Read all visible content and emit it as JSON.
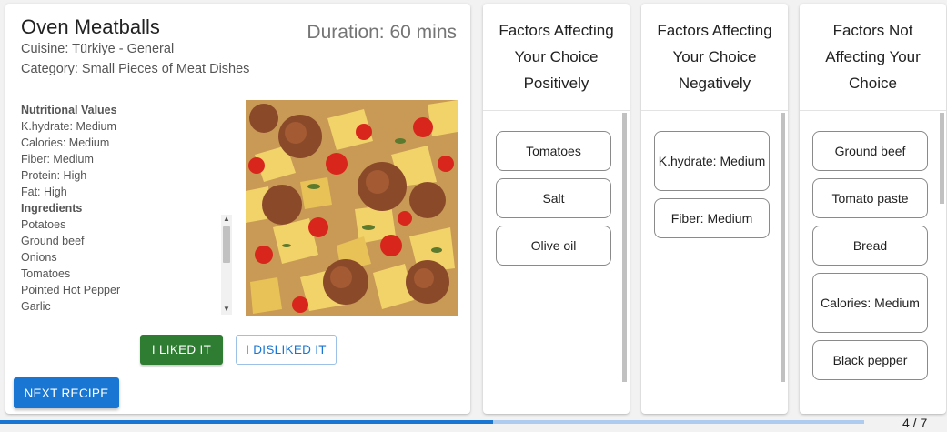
{
  "recipe": {
    "title": "Oven Meatballs",
    "cuisine": "Cuisine: Türkiye - General",
    "category": "Category: Small Pieces of Meat Dishes",
    "duration": "Duration: 60 mins",
    "info_lines": [
      {
        "text": "Nutritional Values",
        "heading": true
      },
      {
        "text": "K.hydrate: Medium",
        "heading": false
      },
      {
        "text": "Calories: Medium",
        "heading": false
      },
      {
        "text": "Fiber: Medium",
        "heading": false
      },
      {
        "text": "Protein: High",
        "heading": false
      },
      {
        "text": "Fat: High",
        "heading": false
      },
      {
        "text": "Ingredients",
        "heading": true
      },
      {
        "text": "Potatoes",
        "heading": false
      },
      {
        "text": "Ground beef",
        "heading": false
      },
      {
        "text": "Onions",
        "heading": false
      },
      {
        "text": "Tomatoes",
        "heading": false
      },
      {
        "text": "Pointed Hot Pepper",
        "heading": false
      },
      {
        "text": "Garlic",
        "heading": false
      }
    ]
  },
  "buttons": {
    "like": "I LIKED IT",
    "dislike": "I DISLIKED IT",
    "next": "NEXT RECIPE"
  },
  "factors": {
    "positive": {
      "title": "Factors Affecting Your Choice Positively",
      "items": [
        "Tomatoes",
        "Salt",
        "Olive oil"
      ]
    },
    "negative": {
      "title": "Factors Affecting Your Choice Negatively",
      "items": [
        "K.hydrate: Medium",
        "Fiber: Medium"
      ]
    },
    "neutral": {
      "title": "Factors Not Affecting Your Choice",
      "items": [
        "Ground beef",
        "Tomato paste",
        "Bread",
        "Calories: Medium",
        "Black pepper"
      ]
    }
  },
  "progress": {
    "label": "4 / 7",
    "fraction": 0.571
  },
  "colors": {
    "like": "#2e7d32",
    "primary": "#1976d2",
    "progress_track": "#aecbf0"
  }
}
